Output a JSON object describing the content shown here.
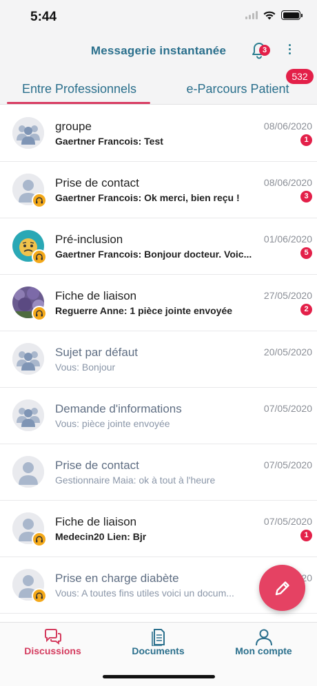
{
  "status_bar": {
    "time": "5:44"
  },
  "header": {
    "title": "Messagerie instantanée",
    "notifications_count": "3"
  },
  "tabs": [
    {
      "label": "Entre Professionnels",
      "active": true
    },
    {
      "label": "e-Parcours Patient",
      "badge": "532"
    }
  ],
  "conversations": [
    {
      "title": "groupe",
      "preview": "Gaertner Francois: Test",
      "date": "08/06/2020",
      "unread": "1",
      "avatar": "group-avatar-icon",
      "read": false,
      "sub_badge": false
    },
    {
      "title": "Prise de contact",
      "preview": "Gaertner Francois: Ok merci, bien reçu !",
      "date": "08/06/2020",
      "unread": "3",
      "avatar": "person-avatar-icon",
      "read": false,
      "sub_badge": true
    },
    {
      "title": "Pré-inclusion",
      "preview": "Gaertner Francois: Bonjour docteur. Voic...",
      "date": "01/06/2020",
      "unread": "5",
      "avatar": "worried-face-avatar",
      "read": false,
      "sub_badge": true
    },
    {
      "title": "Fiche de liaison",
      "preview": "Reguerre Anne: 1 pièce jointe envoyée",
      "date": "27/05/2020",
      "unread": "2",
      "avatar": "photo-avatar",
      "read": false,
      "sub_badge": true
    },
    {
      "title": "Sujet par défaut",
      "preview": "Vous: Bonjour",
      "date": "20/05/2020",
      "unread": "",
      "avatar": "group-avatar-icon",
      "read": true,
      "sub_badge": false
    },
    {
      "title": "Demande d'informations",
      "preview": "Vous: pièce jointe envoyée",
      "date": "07/05/2020",
      "unread": "",
      "avatar": "group-avatar-icon",
      "read": true,
      "sub_badge": false
    },
    {
      "title": "Prise de contact",
      "preview": "Gestionnaire Maia: ok à tout à l'heure",
      "date": "07/05/2020",
      "unread": "",
      "avatar": "person-avatar-icon",
      "read": true,
      "sub_badge": false
    },
    {
      "title": "Fiche de liaison",
      "preview": "Medecin20 Lien: Bjr",
      "date": "07/05/2020",
      "unread": "1",
      "avatar": "person-avatar-icon",
      "read": false,
      "sub_badge": true
    },
    {
      "title": "Prise en charge diabète",
      "preview": "Vous: A toutes fins utiles voici un docum...",
      "date": "20",
      "unread": "",
      "avatar": "person-avatar-icon",
      "read": true,
      "sub_badge": true
    }
  ],
  "bottom_nav": [
    {
      "label": "Discussions",
      "icon": "chat-bubbles-icon",
      "active": true
    },
    {
      "label": "Documents",
      "icon": "document-icon"
    },
    {
      "label": "Mon compte",
      "icon": "user-icon"
    }
  ],
  "colors": {
    "brand": "#2a6f8c",
    "accent": "#d83a60",
    "badge": "#e32049",
    "fab": "#e54263",
    "sub_badge": "#f4a91a"
  }
}
